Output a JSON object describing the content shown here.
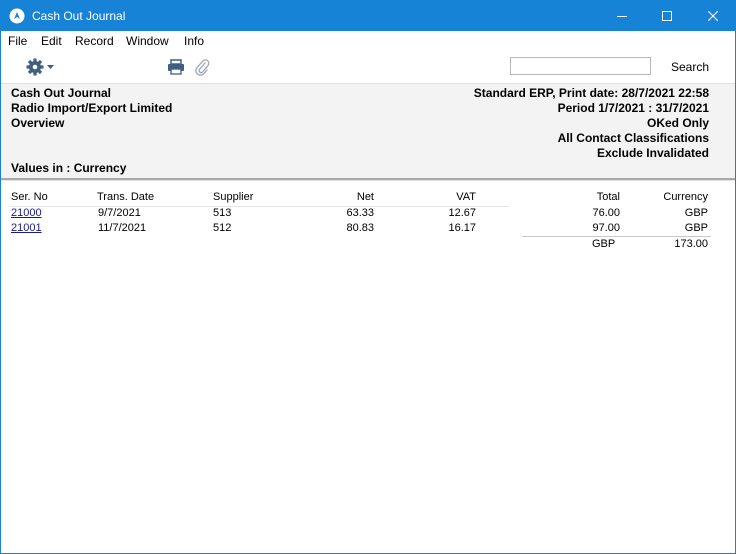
{
  "window": {
    "title": "Cash Out Journal",
    "accent_color": "#1783d7",
    "app_icon": "app-logo-icon",
    "controls": [
      "minimize-icon",
      "maximize-icon",
      "close-icon"
    ]
  },
  "menu": {
    "items": [
      {
        "label": "File"
      },
      {
        "label": "Edit"
      },
      {
        "label": "Record"
      },
      {
        "label": "Window"
      },
      {
        "label": "Info"
      }
    ]
  },
  "toolbar": {
    "icons": [
      "gear-icon",
      "printer-icon",
      "paperclip-icon"
    ],
    "search_value": "",
    "search_label": "Search"
  },
  "report": {
    "title": "Cash Out Journal",
    "company": "Radio Import/Export Limited",
    "mode": "Overview",
    "values_in": "Values in : Currency",
    "print_info": "Standard ERP, Print date: 28/7/2021 22:58",
    "period": "Period  1/7/2021 : 31/7/2021",
    "filter_oked": "OKed Only",
    "filter_contacts": "All Contact Classifications",
    "filter_exclude": "Exclude  Invalidated"
  },
  "table": {
    "columns": [
      "Ser. No",
      "Trans. Date",
      "Supplier",
      "Net",
      "VAT",
      "Total",
      "Currency"
    ],
    "rows": [
      {
        "ser_no": "21000",
        "date": "9/7/2021",
        "supplier": "513",
        "net": "63.33",
        "vat": "12.67",
        "total": "76.00",
        "currency": "GBP"
      },
      {
        "ser_no": "21001",
        "date": "11/7/2021",
        "supplier": "512",
        "net": "80.83",
        "vat": "16.17",
        "total": "97.00",
        "currency": "GBP"
      }
    ],
    "totals": {
      "currency": "GBP",
      "total": "173.00"
    }
  }
}
